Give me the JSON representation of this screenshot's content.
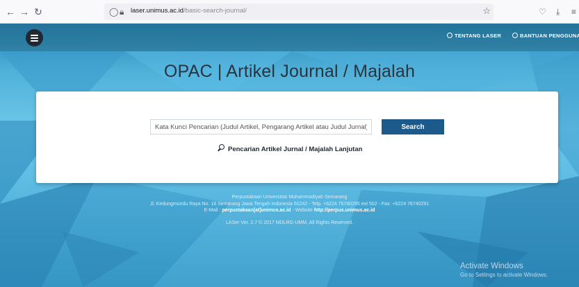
{
  "browser": {
    "url_host": "laser.unimus.ac.id",
    "url_path": "/basic-search-journal/",
    "back_glyph": "←",
    "forward_glyph": "→",
    "reload_glyph": "↻",
    "star_glyph": "☆"
  },
  "nav": {
    "about_label": "TENTANG LASER",
    "help_label": "BANTUAN PENGGUNA"
  },
  "page": {
    "title": "OPAC | Artikel Journal / Majalah"
  },
  "search": {
    "placeholder": "Kata Kunci Pencarian (Judul Artikel, Pengarang Artikel atau Judul Jurnal)",
    "value": "",
    "button_label": "Search",
    "advanced_label": "Pencarian Artikel Jurnal / Majalah Lanjutan"
  },
  "footer": {
    "institution": "Perpustakaan Universitas Muhammadiyah Semarang",
    "address": "Jl. Kedungmundu Raya No. 18 Semarang Jawa Tengah Indonesia 50242 - Telp. +6224 76740295 ext 502 - Fax. +6224 76740291",
    "email_prefix": "E-Mail : ",
    "email": "perpustakaan[at]unimus.ac.id",
    "website_prefix": " - Website ",
    "website": "http://perpus.unimus.ac.id",
    "version": "LASer Ver. 2.7 © 2017 MDLRG-UMM, All Rights Reserved."
  },
  "watermark": {
    "line1": "Activate Windows",
    "line2": "Go to Settings to activate Windows."
  },
  "colors": {
    "accent": "#1c5a8c",
    "menu_button": "#1f2833"
  }
}
